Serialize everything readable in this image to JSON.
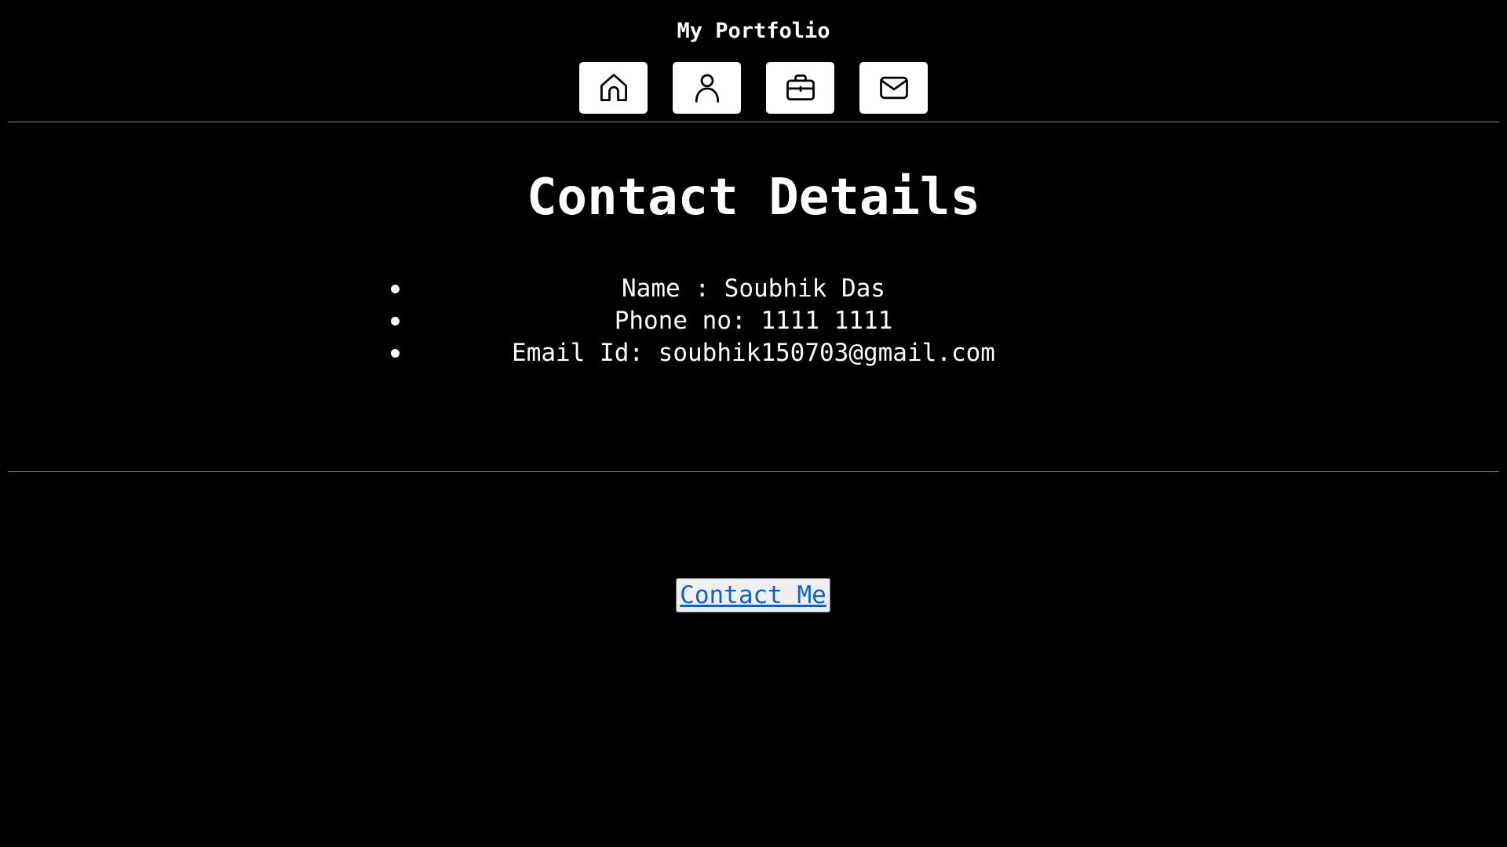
{
  "header": {
    "title": "My Portfolio",
    "nav": [
      {
        "icon": "home-icon"
      },
      {
        "icon": "user-icon"
      },
      {
        "icon": "briefcase-icon"
      },
      {
        "icon": "mail-icon"
      }
    ]
  },
  "main": {
    "title": "Contact Details",
    "details": [
      {
        "text": "Name : Soubhik Das"
      },
      {
        "text": "Phone no: 1111 1111"
      },
      {
        "text": "Email Id: soubhik150703@gmail.com"
      }
    ]
  },
  "footer": {
    "contact_button_label": "Contact Me"
  },
  "colors": {
    "background": "#000000",
    "text": "#ffffff",
    "link": "#0b63c9",
    "button_bg": "#efefef"
  }
}
